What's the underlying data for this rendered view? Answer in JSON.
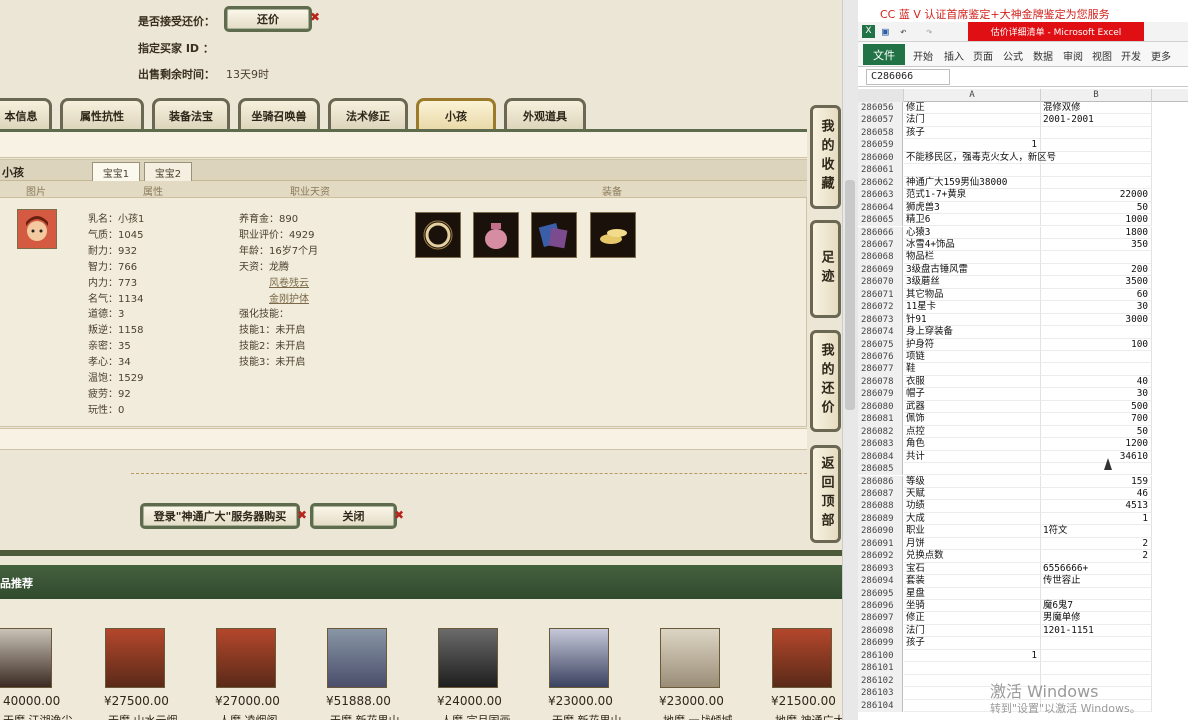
{
  "left": {
    "accept_counter_label": "是否接受还价：",
    "counter_button": "还价",
    "buyer_id_label": "指定买家 ID ：",
    "time_left_label": "出售剩余时间：",
    "time_left_value": "13天9时",
    "tabs": [
      "本信息",
      "属性抗性",
      "装备法宝",
      "坐骑召唤兽",
      "法术修正",
      "小孩",
      "外观道具"
    ],
    "active_tab": "小孩",
    "panel_title": "小孩",
    "subtabs": [
      "宝宝1",
      "宝宝2"
    ],
    "col_headers": [
      "图片",
      "属性",
      "职业天资",
      "装备"
    ],
    "attrs": [
      "乳名：小孩1",
      "气质：1045",
      "耐力：932",
      "智力：766",
      "内力：773",
      "名气：1134",
      "道德：3",
      "叛逆：1158",
      "亲密：35",
      "孝心：34",
      "温饱：1529",
      "疲劳：92",
      "玩性：0"
    ],
    "career": [
      "养育金：890",
      "职业评价：4929",
      "年龄：16岁7个月",
      "天资：龙腾"
    ],
    "talent_links": [
      "风卷残云",
      "金刚护体"
    ],
    "enhance_label": "强化技能：",
    "skills": [
      "技能1：未开启",
      "技能2：未开启",
      "技能3：未开启"
    ],
    "buy_button": "登录\"神通广大\"服务器购买",
    "close_button": "关闭",
    "recommend_title": "品推荐",
    "side_buttons": [
      "我的收藏",
      "足迹",
      "我的还价",
      "返回顶部"
    ],
    "cards": [
      {
        "price": "40000.00",
        "name": "天魔 江湖逸尘"
      },
      {
        "price": "¥27500.00",
        "name": "天魔 山水云烟"
      },
      {
        "price": "¥27000.00",
        "name": "人魔 凌烟阁"
      },
      {
        "price": "¥51888.00",
        "name": "天魔 新花果山"
      },
      {
        "price": "¥24000.00",
        "name": "人魔 宗月国画"
      },
      {
        "price": "¥23000.00",
        "name": "天魔 新花果山"
      },
      {
        "price": "¥23000.00",
        "name": "地魔 一战倾城"
      },
      {
        "price": "¥21500.00",
        "name": "地魔 神通广大"
      }
    ]
  },
  "excel": {
    "banner": "CC 蓝 V 认证首席鉴定+大神金牌鉴定为您服务",
    "title": "估价详细清单 - Microsoft Excel",
    "ribbon_file": "文件",
    "ribbon_tabs": [
      "开始",
      "插入",
      "页面",
      "公式",
      "数据",
      "审阅",
      "视图",
      "开发",
      "更多"
    ],
    "namebox": "C286066",
    "col_a": "A",
    "col_b": "B",
    "rows": [
      {
        "n": "286056",
        "a": "修正",
        "b": "混修双修"
      },
      {
        "n": "286057",
        "a": "法门",
        "b": "2001-2001"
      },
      {
        "n": "286058",
        "a": "孩子",
        "b": ""
      },
      {
        "n": "286059",
        "a": "1",
        "b": "",
        "anum": true
      },
      {
        "n": "286060",
        "a": "不能移民区，强毒克火女人，新区号",
        "b": ""
      },
      {
        "n": "286061",
        "a": "",
        "b": ""
      },
      {
        "n": "286062",
        "a": "神通广大159男仙38000",
        "b": ""
      },
      {
        "n": "286063",
        "a": "范式1-7+黄泉",
        "b": "22000",
        "bnum": true
      },
      {
        "n": "286064",
        "a": "狮虎兽3",
        "b": "50",
        "bnum": true
      },
      {
        "n": "286065",
        "a": "精卫6",
        "b": "1000",
        "bnum": true
      },
      {
        "n": "286066",
        "a": "心猿3",
        "b": "1800",
        "bnum": true
      },
      {
        "n": "286067",
        "a": "冰雪4+饰品",
        "b": "350",
        "bnum": true
      },
      {
        "n": "286068",
        "a": "物品栏",
        "b": ""
      },
      {
        "n": "286069",
        "a": "3级盘古锤风雷",
        "b": "200",
        "bnum": true
      },
      {
        "n": "286070",
        "a": "3级蘑丝",
        "b": "3500",
        "bnum": true
      },
      {
        "n": "286071",
        "a": "其它物品",
        "b": "60",
        "bnum": true
      },
      {
        "n": "286072",
        "a": "11星卡",
        "b": "30",
        "bnum": true
      },
      {
        "n": "286073",
        "a": "针91",
        "b": "3000",
        "bnum": true
      },
      {
        "n": "286074",
        "a": "身上穿装备",
        "b": ""
      },
      {
        "n": "286075",
        "a": "护身符",
        "b": "100",
        "bnum": true
      },
      {
        "n": "286076",
        "a": "项链",
        "b": ""
      },
      {
        "n": "286077",
        "a": "鞋",
        "b": ""
      },
      {
        "n": "286078",
        "a": "衣服",
        "b": "40",
        "bnum": true
      },
      {
        "n": "286079",
        "a": "帽子",
        "b": "30",
        "bnum": true
      },
      {
        "n": "286080",
        "a": "武器",
        "b": "500",
        "bnum": true
      },
      {
        "n": "286081",
        "a": "佩饰",
        "b": "700",
        "bnum": true
      },
      {
        "n": "286082",
        "a": "点控",
        "b": "50",
        "bnum": true
      },
      {
        "n": "286083",
        "a": "角色",
        "b": "1200",
        "bnum": true
      },
      {
        "n": "286084",
        "a": "共计",
        "b": "34610",
        "bnum": true
      },
      {
        "n": "286085",
        "a": "",
        "b": ""
      },
      {
        "n": "286086",
        "a": "等级",
        "b": "159",
        "bnum": true
      },
      {
        "n": "286087",
        "a": "天赋",
        "b": "46",
        "bnum": true
      },
      {
        "n": "286088",
        "a": "功绩",
        "b": "4513",
        "bnum": true
      },
      {
        "n": "286089",
        "a": "大成",
        "b": "1",
        "bnum": true
      },
      {
        "n": "286090",
        "a": "职业",
        "b": "1符文"
      },
      {
        "n": "286091",
        "a": "月饼",
        "b": "2",
        "bnum": true
      },
      {
        "n": "286092",
        "a": "兑换点数",
        "b": "2",
        "bnum": true
      },
      {
        "n": "286093",
        "a": "宝石",
        "b": "6556666+"
      },
      {
        "n": "286094",
        "a": "套装",
        "b": "传世容止"
      },
      {
        "n": "286095",
        "a": "星盘",
        "b": ""
      },
      {
        "n": "286096",
        "a": "坐骑",
        "b": "魔6鬼7"
      },
      {
        "n": "286097",
        "a": "修正",
        "b": "男魔单修"
      },
      {
        "n": "286098",
        "a": "法门",
        "b": "1201-1151"
      },
      {
        "n": "286099",
        "a": "孩子",
        "b": ""
      },
      {
        "n": "286100",
        "a": "1",
        "b": "",
        "anum": true
      },
      {
        "n": "286101",
        "a": "",
        "b": ""
      },
      {
        "n": "286102",
        "a": "",
        "b": ""
      },
      {
        "n": "286103",
        "a": "",
        "b": ""
      },
      {
        "n": "286104",
        "a": "",
        "b": ""
      }
    ],
    "watermark_1": "激活 Windows",
    "watermark_2": "转到\"设置\"以激活 Windows。"
  }
}
